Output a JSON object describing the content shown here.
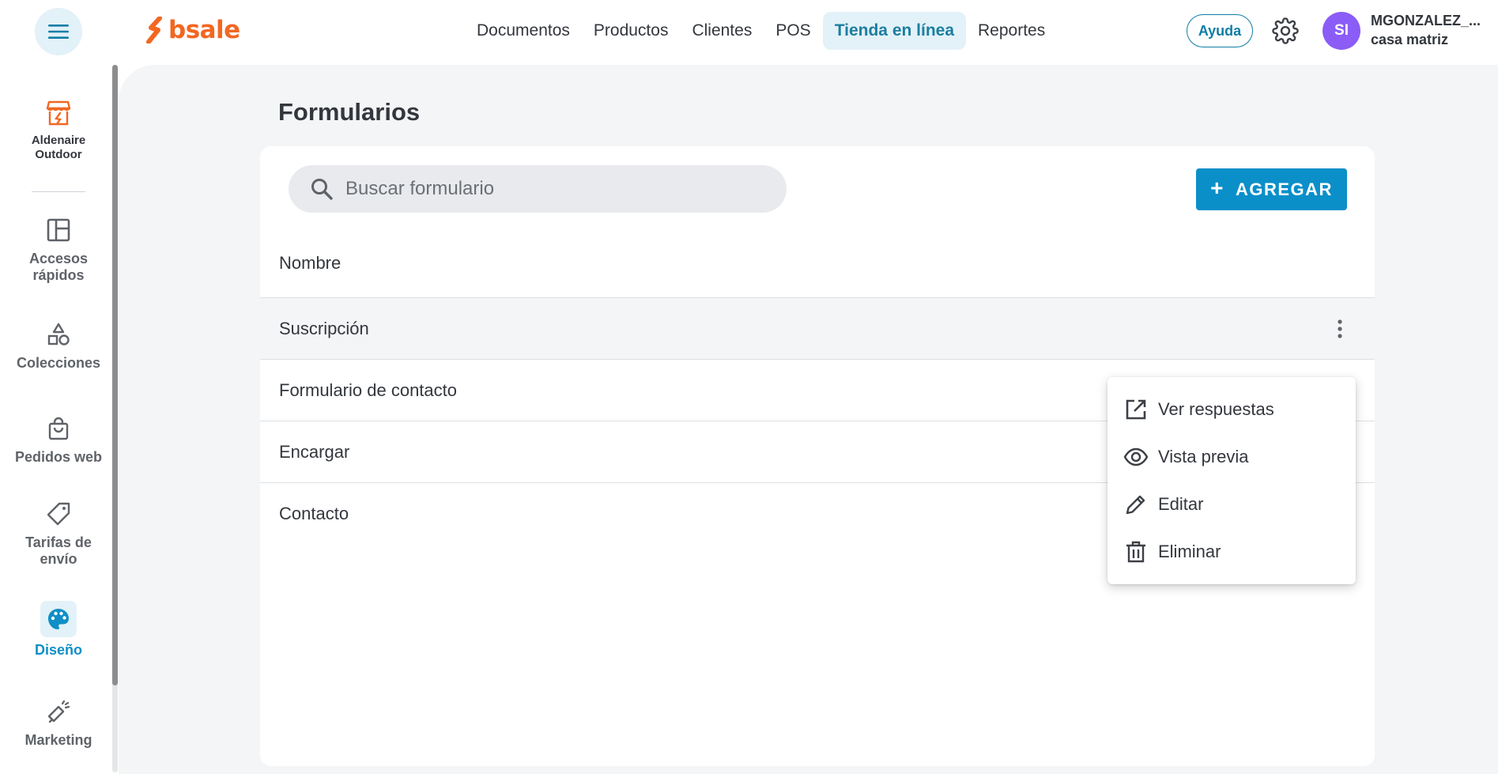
{
  "header": {
    "logo_text": "bsale",
    "nav": [
      {
        "label": "Documentos",
        "active": false
      },
      {
        "label": "Productos",
        "active": false
      },
      {
        "label": "Clientes",
        "active": false
      },
      {
        "label": "POS",
        "active": false
      },
      {
        "label": "Tienda en línea",
        "active": true
      },
      {
        "label": "Reportes",
        "active": false
      }
    ],
    "help_label": "Ayuda",
    "avatar_initials": "SI",
    "user_name": "MGONZALEZ_...",
    "user_branch": "casa matriz"
  },
  "sidebar": {
    "store_name_line1": "Aldenaire",
    "store_name_line2": "Outdoor",
    "items": [
      {
        "label_line1": "Accesos",
        "label_line2": "rápidos",
        "icon": "dashboard-icon"
      },
      {
        "label_line1": "Colecciones",
        "label_line2": "",
        "icon": "shapes-icon"
      },
      {
        "label_line1": "Pedidos web",
        "label_line2": "",
        "icon": "shopping-bag-icon"
      },
      {
        "label_line1": "Tarifas de",
        "label_line2": "envío",
        "icon": "tag-icon"
      },
      {
        "label_line1": "Diseño",
        "label_line2": "",
        "icon": "palette-icon",
        "active": true
      },
      {
        "label_line1": "Marketing",
        "label_line2": "",
        "icon": "megaphone-icon"
      }
    ]
  },
  "main": {
    "title": "Formularios",
    "search_placeholder": "Buscar formulario",
    "add_label": "AGREGAR",
    "add_plus": "+",
    "column_header": "Nombre",
    "rows": [
      {
        "name": "Suscripción"
      },
      {
        "name": "Formulario de contacto"
      },
      {
        "name": "Encargar"
      },
      {
        "name": "Contacto"
      }
    ]
  },
  "menu": {
    "items": [
      {
        "label": "Ver respuestas",
        "icon": "open-external-icon"
      },
      {
        "label": "Vista previa",
        "icon": "eye-icon"
      },
      {
        "label": "Editar",
        "icon": "pencil-icon"
      },
      {
        "label": "Eliminar",
        "icon": "trash-icon"
      }
    ]
  },
  "colors": {
    "brand": "#f26722",
    "accent": "#0b8fc9",
    "avatar": "#8b5cf6"
  }
}
